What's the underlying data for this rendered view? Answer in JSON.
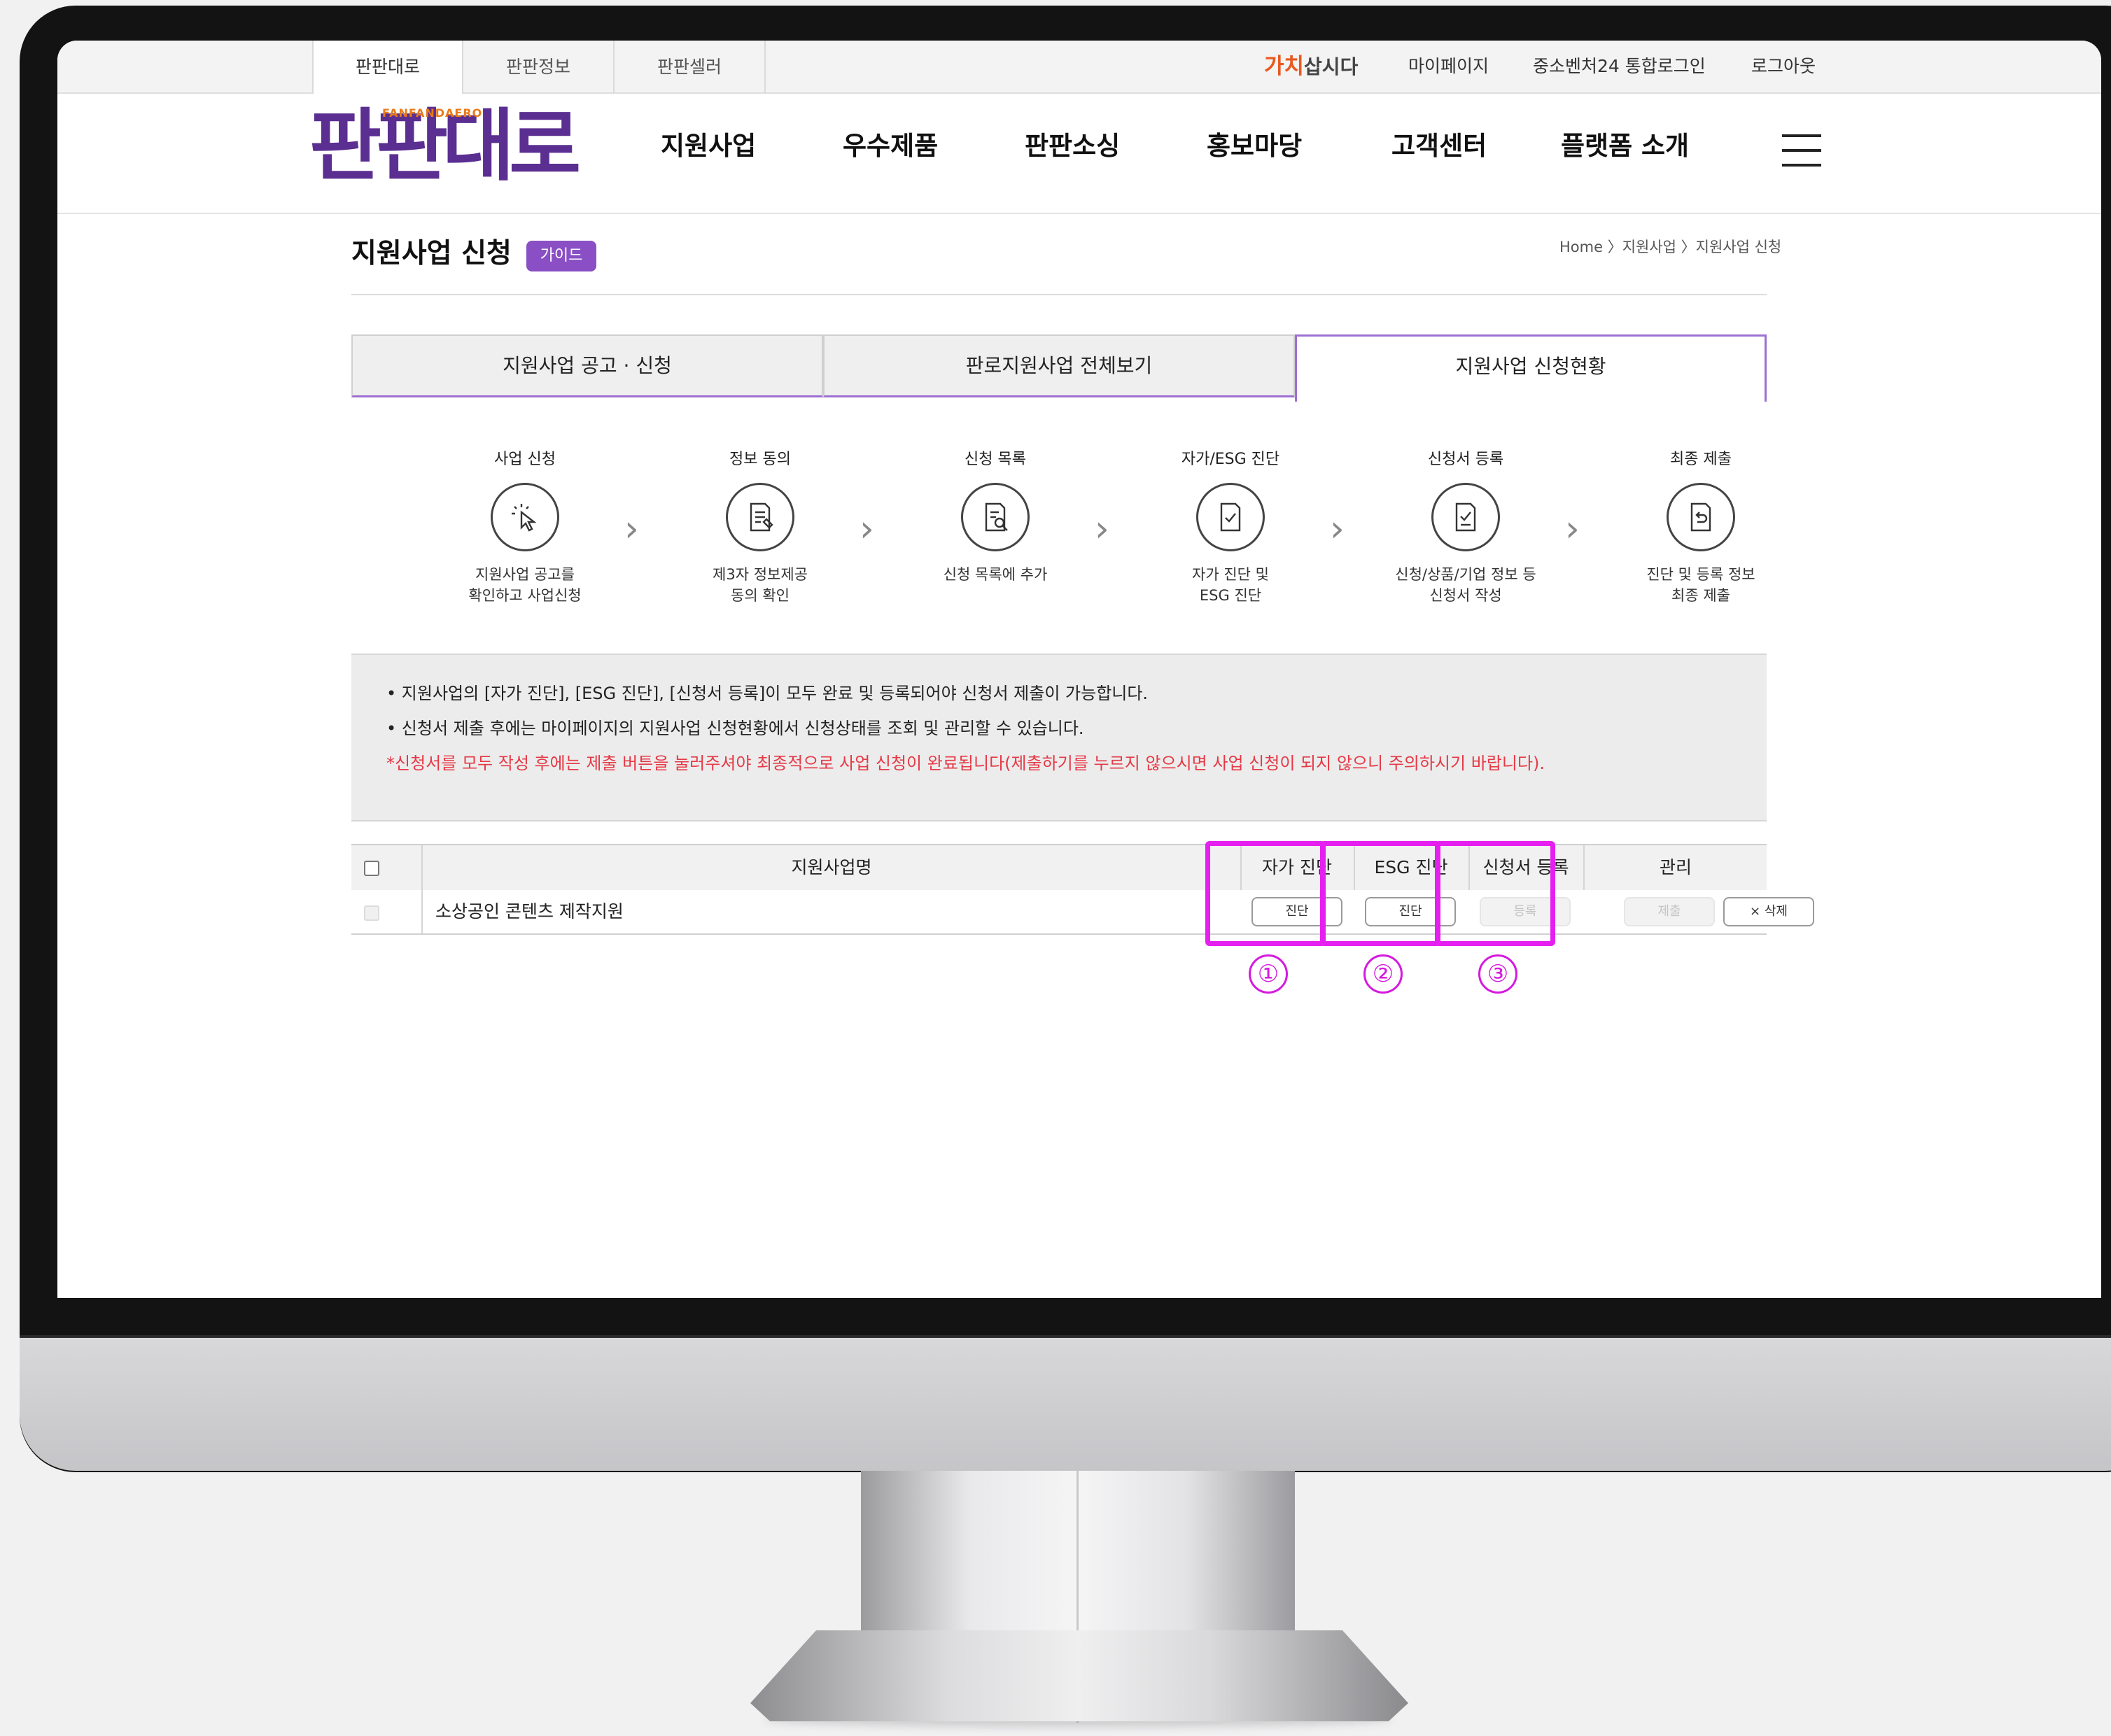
{
  "top_tabs": [
    "판판대로",
    "판판정보",
    "판판셀러"
  ],
  "util_nav": {
    "brand_red": "가치",
    "brand_dark": "삽시다",
    "links": [
      "마이페이지",
      "중소벤처24 통합로그인",
      "로그아웃"
    ]
  },
  "logo": {
    "text": "판판대로",
    "subtext": "FANFANDAERO"
  },
  "gnb": [
    "지원사업",
    "우수제품",
    "판판소싱",
    "홍보마당",
    "고객센터",
    "플랫폼 소개"
  ],
  "page": {
    "title": "지원사업 신청",
    "guide_badge": "가이드",
    "breadcrumb": "Home 〉지원사업 〉지원사업 신청"
  },
  "tabs": [
    "지원사업 공고 · 신청",
    "판로지원사업 전체보기",
    "지원사업 신청현황"
  ],
  "active_tab": 2,
  "steps": [
    {
      "label": "사업 신청",
      "icon": "cursor-click-icon",
      "desc": "지원사업 공고를\n확인하고 사업신청"
    },
    {
      "label": "정보 동의",
      "icon": "document-pen-icon",
      "desc": "제3자 정보제공\n동의 확인"
    },
    {
      "label": "신청 목록",
      "icon": "document-search-icon",
      "desc": "신청 목록에 추가"
    },
    {
      "label": "자가/ESG 진단",
      "icon": "document-check-icon",
      "desc": "자가 진단 및\nESG 진단"
    },
    {
      "label": "신청서 등록",
      "icon": "document-check-icon",
      "desc": "신청/상품/기업 정보 등\n신청서 작성"
    },
    {
      "label": "최종 제출",
      "icon": "document-return-icon",
      "desc": "진단 및 등록 정보\n최종 제출"
    }
  ],
  "notice": [
    "• 지원사업의 [자가 진단], [ESG 진단], [신청서 등록]이 모두 완료 및 등록되어야 신청서 제출이 가능합니다.",
    "• 신청서 제출 후에는 마이페이지의 지원사업 신청현황에서 신청상태를 조회 및 관리할 수 있습니다."
  ],
  "notice_warning": "*신청서를 모두 작성 후에는 제출 버튼을 눌러주셔야 최종적으로 사업 신청이 완료됩니다(제출하기를 누르지 않으시면 사업 신청이 되지 않으니 주의하시기 바랍니다).",
  "table": {
    "headers": {
      "name": "지원사업명",
      "self": "자가 진단",
      "esg": "ESG 진단",
      "reg": "신청서 등록",
      "manage": "관리"
    },
    "rows": [
      {
        "name": "소상공인 콘텐츠 제작지원",
        "self_btn": "진단",
        "esg_btn": "진단",
        "reg_btn": "등록",
        "submit_btn": "제출",
        "delete_btn": "× 삭제"
      }
    ]
  },
  "annotations": [
    "①",
    "②",
    "③"
  ],
  "colors": {
    "brand_purple": "#5b2e91",
    "tab_accent": "#9e6fd1",
    "highlight": "#e51ff0",
    "warning_red": "#e63946"
  }
}
